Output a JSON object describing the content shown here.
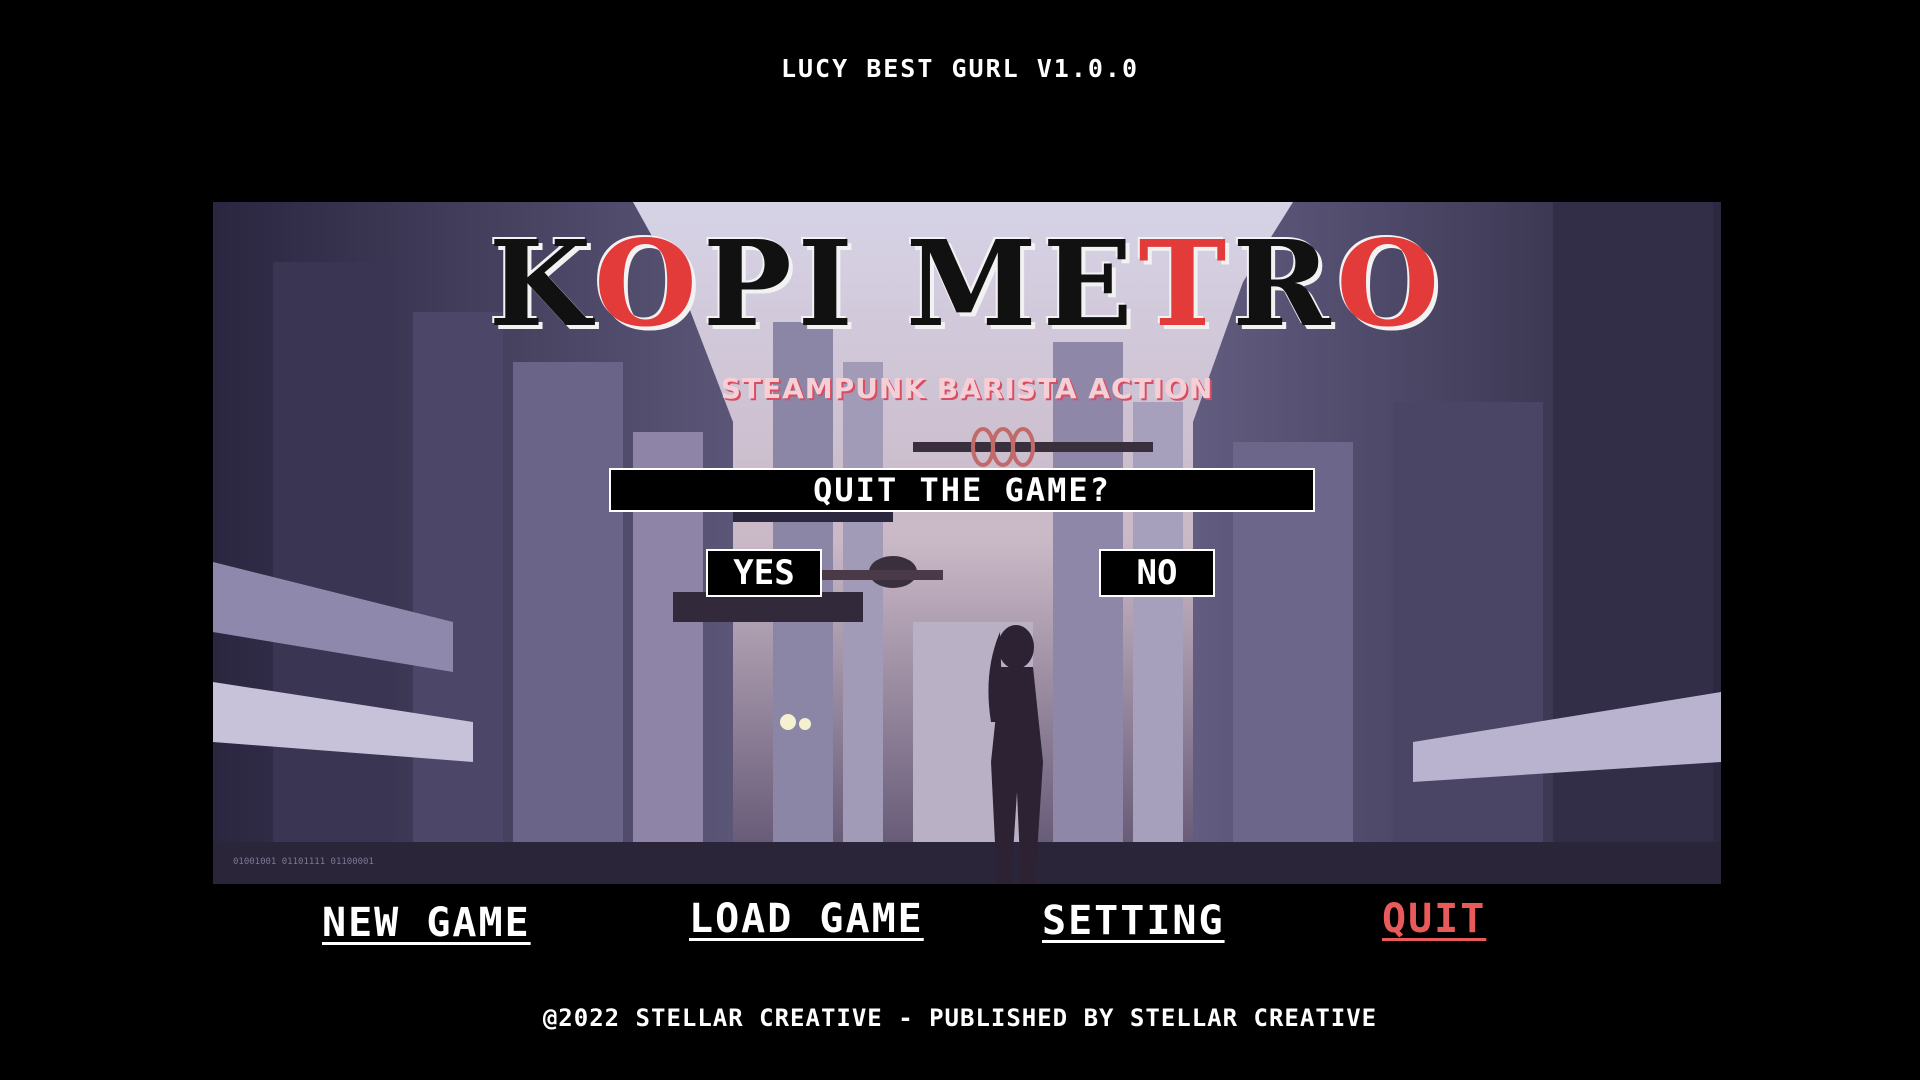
{
  "version_label": "LUCY BEST GURL V1.0.0",
  "game": {
    "logo_parts": [
      "K",
      "O",
      "PI ME",
      "T",
      "R",
      "O"
    ],
    "logo_red_indexes": [
      1,
      3,
      5
    ],
    "tagline": "STEAMPUNK BARISTA ACTION"
  },
  "dialog": {
    "title": "QUIT THE GAME?",
    "yes_label": "YES",
    "no_label": "NO"
  },
  "menu": {
    "new_game": "NEW GAME",
    "load_game": "LOAD GAME",
    "setting": "SETTING",
    "quit": "QUIT"
  },
  "footer": "@2022 STELLAR CREATIVE - PUBLISHED BY STELLAR CREATIVE",
  "colors": {
    "accent": "#e95a5a",
    "logo_red": "#e33a3a",
    "background": "#000000"
  }
}
